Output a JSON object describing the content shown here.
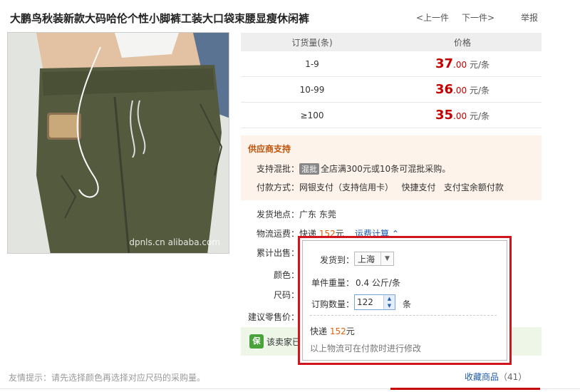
{
  "product": {
    "title": "大鹏鸟秋装新款大码哈伦个性小脚裤工装大口袋束腰显瘦休闲裤"
  },
  "nav": {
    "prev": "<上一件",
    "next": "下一件>",
    "report": "举报"
  },
  "photo": {
    "watermark": "dpnls.cn alibaba.com"
  },
  "price_table": {
    "headers": {
      "qty": "订货量(条)",
      "price": "价格"
    },
    "rows": [
      {
        "qty": "1-9",
        "price_int": "37",
        "price_dec": ".00",
        "unit": "元/条"
      },
      {
        "qty": "10-99",
        "price_int": "36",
        "price_dec": ".00",
        "unit": "元/条"
      },
      {
        "qty": "≥100",
        "price_int": "35",
        "price_dec": ".00",
        "unit": "元/条"
      }
    ]
  },
  "supplier": {
    "title": "供应商支持",
    "mix_label": "支持混批：",
    "mix_tag": "混批",
    "mix_text": "全店满300元或10条可混批采购。",
    "pay_label": "付款方式：",
    "pay_methods": "网银支付（支持信用卡）   快捷支付   支付宝余额付款"
  },
  "attributes": {
    "ship_from_label": "发货地点：",
    "ship_from": "广东 东莞",
    "logistics_label": "物流运费：",
    "logistics_method": "快递",
    "logistics_fee": "152",
    "logistics_unit": "元",
    "freight_calc": "运费计算",
    "sold_label": "累计出售：",
    "color_label": "颜色：",
    "size_label": "尺码：",
    "retail_label": "建议零售价："
  },
  "guarantee": {
    "icon": "保",
    "text": "该卖家已"
  },
  "popup": {
    "ship_to_label": "发货到：",
    "ship_to": "上海",
    "weight_label": "单件重量：",
    "weight": "0.4 公斤/条",
    "qty_label": "订购数量：",
    "qty": "122",
    "qty_unit": "条",
    "express": "快递",
    "fee": "152",
    "fee_unit": "元",
    "note": "以上物流可在付款时进行修改"
  },
  "footer": {
    "tip": "友情提示：请先选择颜色再选择对应尺码的采购量。",
    "favorite": "收藏商品",
    "favorite_count": "（41）"
  },
  "colors": {
    "price_red": "#c40000",
    "highlight_red": "#d0161c",
    "orange": "#e4600a",
    "link_blue": "#1e5ba8",
    "pants_green": "#545a3e"
  }
}
